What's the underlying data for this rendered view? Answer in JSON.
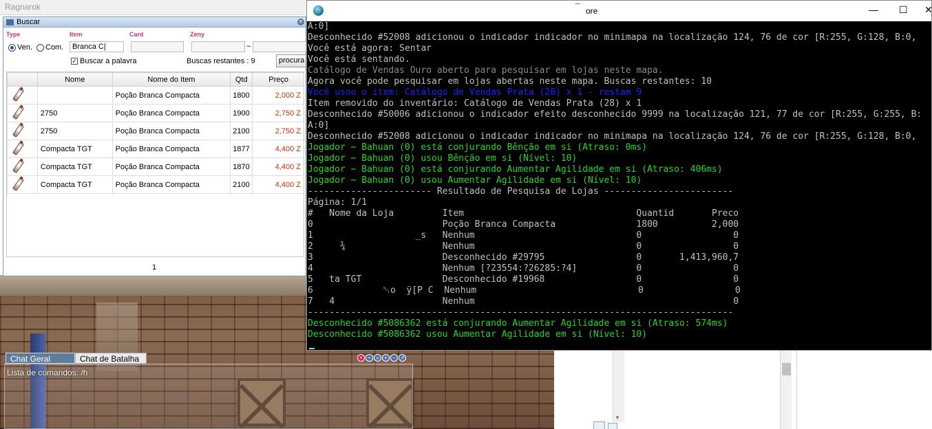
{
  "game_window": {
    "title": "Ragnarok"
  },
  "buscar": {
    "title": "Buscar",
    "labels": {
      "type": "Type",
      "item": "Item",
      "card": "Card",
      "zeny": "Zeny"
    },
    "type_options": [
      "Ven.",
      "Com."
    ],
    "item_input": "Branca C|",
    "zeny_separator": "~",
    "buscar_palavra": "Buscar a palavra",
    "buscas_restantes": "Buscas restantes : 9",
    "search_button": "procura",
    "table": {
      "headers": [
        "Nome",
        "Nome do Item",
        "Qtd",
        "Preço"
      ],
      "rows": [
        {
          "nome": "",
          "item": "Poção Branca Compacta",
          "qtd": "1800",
          "preco": "2,000 Z"
        },
        {
          "nome": "2750",
          "item": "Poção Branca Compacta",
          "qtd": "1900",
          "preco": "2,750 Z"
        },
        {
          "nome": "2750",
          "item": "Poção Branca Compacta",
          "qtd": "2100",
          "preco": "2,750 Z"
        },
        {
          "nome": "Compacta TGT",
          "item": "Poção Branca Compacta",
          "qtd": "1877",
          "preco": "4,400 Z"
        },
        {
          "nome": "Compacta TGT",
          "item": "Poção Branca Compacta",
          "qtd": "1870",
          "preco": "4,400 Z"
        },
        {
          "nome": "Compacta TGT",
          "item": "Poção Branca Compacta",
          "qtd": "2100",
          "preco": "4,400 Z"
        }
      ]
    },
    "page": "1"
  },
  "chat": {
    "tabs": [
      "Chat Geral",
      "Chat de Batalha"
    ],
    "line": "Lista de comandos: /h"
  },
  "console": {
    "title": "ore",
    "title_prefix": "¯",
    "buttons": {
      "minimize": "—",
      "maximize": "☐",
      "close": "✕"
    },
    "lines": [
      {
        "t": "A:0]",
        "c": ""
      },
      {
        "t": "Desconhecido #52008 adicionou o indicador indicador no minimapa na localização 124, 76 de cor [R:255, G:128, B:0,",
        "c": ""
      },
      {
        "t": "Você está agora: Sentar",
        "c": ""
      },
      {
        "t": "Você está sentando.",
        "c": ""
      },
      {
        "t": "Catálogo de Vendas Ouro aberto para pesquisar em lojas neste mapa.",
        "c": "gray"
      },
      {
        "t": "Agora você pode pesquisar em lojas abertas neste mapa. Buscas restantes: 10",
        "c": ""
      },
      {
        "t": "Você usou o item: Catálogo de Vendas Prata (28) x 1 - restam 9",
        "c": "blue"
      },
      {
        "t": "Item removido do inventário: Catálogo de Vendas Prata (28) x 1",
        "c": ""
      },
      {
        "t": "Desconhecido #50006 adicionou o indicador efeito desconhecido 9999 na localização 121, 77 de cor [R:255, G:255, B:",
        "c": ""
      },
      {
        "t": "A:0]",
        "c": ""
      },
      {
        "t": "Desconhecido #52008 adicionou o indicador indicador no minimapa na localização 124, 76 de cor [R:255, G:128, B:0,",
        "c": ""
      },
      {
        "t": "Jogador ~ Bahuan (0) está conjurando Bênção em si (Atraso: 0ms)",
        "c": "green"
      },
      {
        "t": "Jogador ~ Bahuan (0) usou Bênção em si (Nível: 10)",
        "c": "green"
      },
      {
        "t": "Jogador ~ Bahuan (0) está conjurando Aumentar Agilidade em si (Atraso: 406ms)",
        "c": "green"
      },
      {
        "t": "Jogador ~ Bahuan (0) usou Aumentar Agilidade em si (Nível: 10)",
        "c": "green"
      },
      {
        "t": "----------------------- Resultado de Pesquisa de Lojas ------------------------",
        "c": ""
      },
      {
        "t": "Página: 1/1",
        "c": ""
      },
      {
        "t": "#   Nome da Loja         Item                                Quantid       Preco",
        "c": ""
      },
      {
        "t": "0                        Poção Branca Compacta               1800          2,000",
        "c": ""
      },
      {
        "t": "1                   _s   Nenhum                              0                 0",
        "c": ""
      },
      {
        "t": "2     ¾                  Nenhum                              0                 0",
        "c": ""
      },
      {
        "t": "3                        Desconhecido #29795                 0       1,413,960,7",
        "c": ""
      },
      {
        "t": "4                        Nenhum [?23554:?26285:?4]           0                 0",
        "c": ""
      },
      {
        "t": "5   ta TGT               Desconhecido #19968                 0                 0",
        "c": ""
      },
      {
        "t": "6             ␀o  ÿ[P C  Nenhum                              0                 0",
        "c": ""
      },
      {
        "t": "7   4                    Nenhum                                                0",
        "c": ""
      },
      {
        "t": "-------------------------------------------------------------------------------",
        "c": ""
      },
      {
        "t": "Desconhecido #5086362 está conjurando Aumentar Agilidade em si (Atraso: 574ms)",
        "c": "green"
      },
      {
        "t": "Desconhecido #5086362 usou Aumentar Agilidade em si (Nível: 10)",
        "c": "green"
      }
    ]
  }
}
